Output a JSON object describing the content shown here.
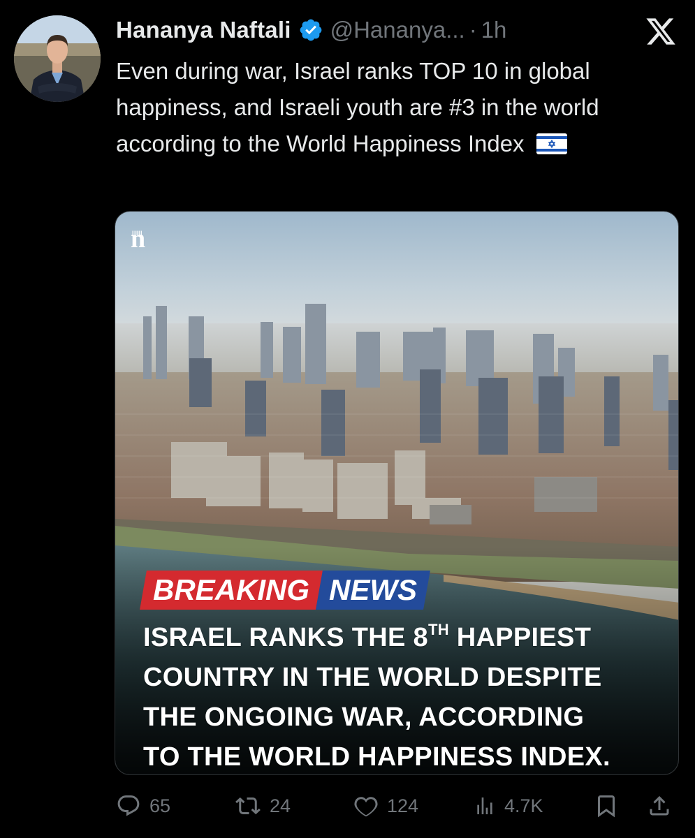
{
  "post": {
    "author": {
      "display_name": "Hananya Naftali",
      "handle": "@Hananya...",
      "verified": true
    },
    "separator": "·",
    "time": "1h",
    "text": "Even during war, Israel ranks TOP 10 in global happiness, and Israeli youth are #3 in the world according to the World Happiness Index",
    "text_emoji": "israel-flag-icon"
  },
  "media": {
    "publisher_mark": "n",
    "publisher_mark_small": "IIIII",
    "banner": {
      "breaking": "BREAKING",
      "news": "NEWS"
    },
    "headline": {
      "line1_pre": "ISRAEL RANKS THE 8",
      "line1_sup": "TH",
      "line1_post": " HAPPIEST",
      "line2": "COUNTRY IN THE WORLD DESPITE",
      "line3": "THE ONGOING WAR, ACCORDING",
      "line4": "TO THE WORLD HAPPINESS INDEX."
    }
  },
  "actions": {
    "replies": "65",
    "reposts": "24",
    "likes": "124",
    "views": "4.7K"
  },
  "colors": {
    "background": "#000000",
    "text": "#e7e9ea",
    "secondary": "#71767b",
    "verified": "#1d9bf0",
    "breaking_red": "#d42a2f",
    "news_blue": "#234b9b"
  }
}
